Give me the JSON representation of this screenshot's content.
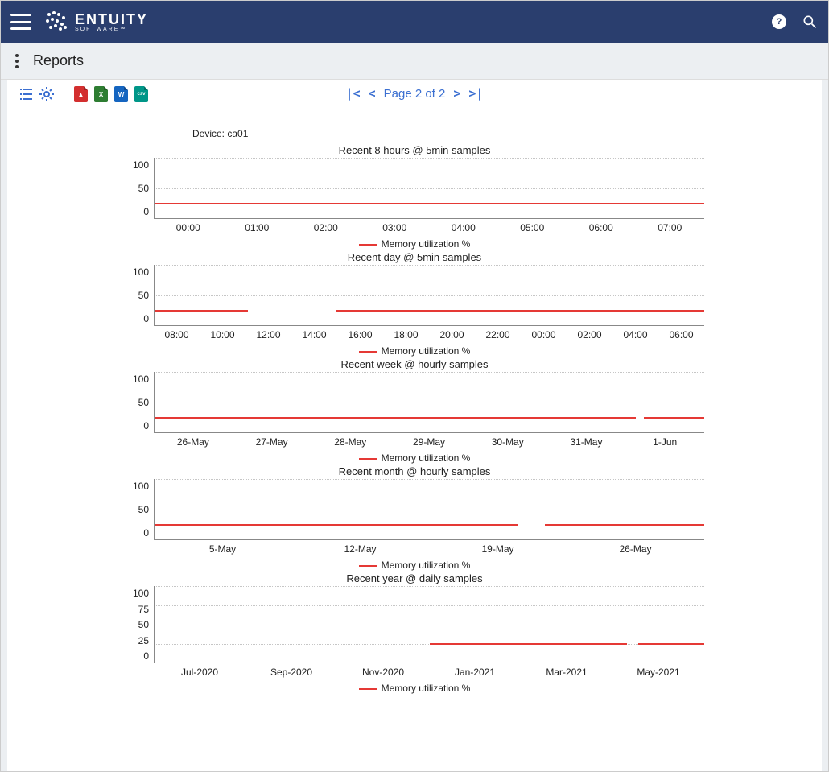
{
  "app": {
    "brand": "ENTUITY",
    "sub": "SOFTWARE™"
  },
  "page": {
    "title": "Reports"
  },
  "toolbar": {
    "export": {
      "pdf": "PDF",
      "xls": "XLS",
      "doc": "DOC",
      "csv": "CSV"
    }
  },
  "paginator": {
    "label": "Page 2 of 2",
    "first": "|<",
    "prev": "<",
    "next": ">",
    "last": ">|"
  },
  "report": {
    "device_label": "Device: ca01",
    "legend": "Memory utilization %"
  },
  "chart_data": [
    {
      "type": "line",
      "title": "Recent 8 hours @ 5min samples",
      "ylabel": "",
      "xlabel": "",
      "ylim": [
        0,
        100
      ],
      "yticks": [
        0,
        50,
        100
      ],
      "categories": [
        "00:00",
        "01:00",
        "02:00",
        "03:00",
        "04:00",
        "05:00",
        "06:00",
        "07:00"
      ],
      "series": [
        {
          "name": "Memory utilization %",
          "values": [
            25,
            25,
            25,
            25,
            25,
            25,
            25,
            25
          ]
        }
      ],
      "gaps": []
    },
    {
      "type": "line",
      "title": "Recent day @ 5min samples",
      "ylabel": "",
      "xlabel": "",
      "ylim": [
        0,
        100
      ],
      "yticks": [
        0,
        50,
        100
      ],
      "categories": [
        "08:00",
        "10:00",
        "12:00",
        "14:00",
        "16:00",
        "18:00",
        "20:00",
        "22:00",
        "00:00",
        "02:00",
        "04:00",
        "06:00"
      ],
      "series": [
        {
          "name": "Memory utilization %",
          "values": [
            25,
            25,
            null,
            null,
            25,
            25,
            25,
            25,
            25,
            25,
            25,
            25
          ]
        }
      ],
      "gaps": [
        [
          0.17,
          0.33
        ]
      ]
    },
    {
      "type": "line",
      "title": "Recent week @ hourly samples",
      "ylabel": "",
      "xlabel": "",
      "ylim": [
        0,
        100
      ],
      "yticks": [
        0,
        50,
        100
      ],
      "categories": [
        "26-May",
        "27-May",
        "28-May",
        "29-May",
        "30-May",
        "31-May",
        "1-Jun"
      ],
      "series": [
        {
          "name": "Memory utilization %",
          "values": [
            25,
            25,
            25,
            25,
            25,
            25,
            25
          ]
        }
      ],
      "gaps": [
        [
          0.875,
          0.89
        ]
      ]
    },
    {
      "type": "line",
      "title": "Recent month @ hourly samples",
      "ylabel": "",
      "xlabel": "",
      "ylim": [
        0,
        100
      ],
      "yticks": [
        0,
        50,
        100
      ],
      "categories": [
        "5-May",
        "12-May",
        "19-May",
        "26-May"
      ],
      "series": [
        {
          "name": "Memory utilization %",
          "values": [
            25,
            25,
            25,
            25
          ]
        }
      ],
      "gaps": [
        [
          0.66,
          0.71
        ]
      ]
    },
    {
      "type": "line",
      "title": "Recent year @ daily samples",
      "ylabel": "",
      "xlabel": "",
      "ylim": [
        0,
        100
      ],
      "yticks": [
        0,
        25,
        50,
        75,
        100
      ],
      "categories": [
        "Jul-2020",
        "Sep-2020",
        "Nov-2020",
        "Jan-2021",
        "Mar-2021",
        "May-2021"
      ],
      "series": [
        {
          "name": "Memory utilization %",
          "values": [
            null,
            null,
            null,
            25,
            25,
            25
          ]
        }
      ],
      "gaps": [
        [
          0.0,
          0.5
        ],
        [
          0.86,
          0.88
        ]
      ]
    }
  ]
}
